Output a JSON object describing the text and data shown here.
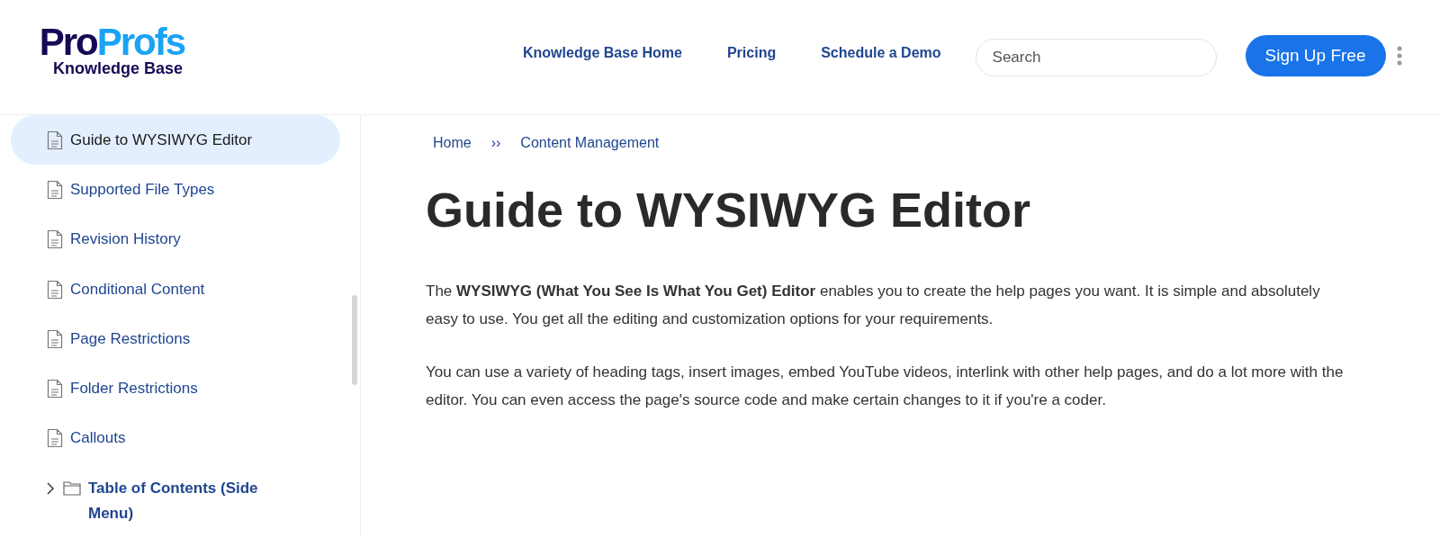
{
  "header": {
    "logo": {
      "part_1": "Pro",
      "part_2": "Profs",
      "subtitle": "Knowledge Base"
    },
    "nav": [
      "Knowledge Base Home",
      "Pricing",
      "Schedule a Demo"
    ],
    "search": {
      "placeholder": "Search"
    },
    "signup_button": "Sign Up Free"
  },
  "sidebar": {
    "items": [
      {
        "kind": "page",
        "label": "Guide to WYSIWYG Editor",
        "selected": true
      },
      {
        "kind": "page",
        "label": "Supported File Types",
        "selected": false
      },
      {
        "kind": "page",
        "label": "Revision History",
        "selected": false
      },
      {
        "kind": "page",
        "label": "Conditional Content",
        "selected": false
      },
      {
        "kind": "page",
        "label": "Page Restrictions",
        "selected": false
      },
      {
        "kind": "page",
        "label": "Folder Restrictions",
        "selected": false
      },
      {
        "kind": "page",
        "label": "Callouts",
        "selected": false
      },
      {
        "kind": "folder",
        "label": "Table of Contents (Side Menu)",
        "selected": false,
        "expanded": false
      }
    ]
  },
  "breadcrumb": {
    "items": [
      "Home",
      "Content Management"
    ],
    "separator": "››"
  },
  "article": {
    "title": "Guide to WYSIWYG Editor",
    "paragraphs": [
      "The **WYSIWYG (What You See Is What You Get) Editor** enables you to create the help pages you want. It is simple and absolutely easy to use. You get all the editing and customization options for your requirements.",
      "You can use a variety of heading tags, insert images, embed YouTube videos, interlink with other help pages, and do a lot more with the editor. You can even access the page's source code and make certain changes to it if you're a coder."
    ]
  }
}
